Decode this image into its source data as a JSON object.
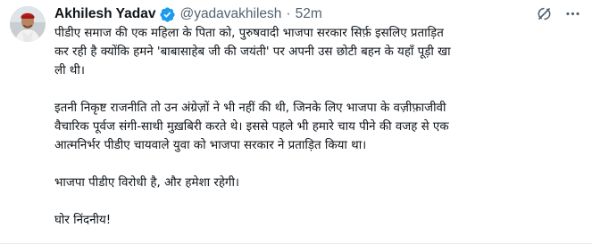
{
  "tweet": {
    "author": {
      "name": "Akhilesh Yadav",
      "handle": "@yadavakhilesh",
      "separator": "·",
      "time": "52m",
      "verified": true,
      "verified_color": "#1d9bf0",
      "avatar_icon": "profile-photo"
    },
    "actions": {
      "grok_icon": "grok-icon",
      "more_icon": "more-horizontal-icon"
    },
    "paragraphs": [
      {
        "lines": [
          "पीडीए समाज की एक महिला के पिता को, पुरुषवादी भाजपा सरकार सिर्फ़ इसलिए प्रताड़ित",
          "कर रही है क्योंकि हमने 'बाबासाहेब जी की जयंती' पर अपनी उस छोटी बहन के यहाँ पूड़ी खा",
          "ली थी।"
        ]
      },
      {
        "lines": [
          "इतनी निकृष्ट राजनीति तो उन अंग्रेज़ों ने भी नहीं की थी, जिनके लिए भाजपा के वज़ीफ़ाजीवी",
          "वैचारिक पूर्वज संगी-साथी मुख़बिरी करते थे। इससे पहले भी हमारे चाय पीने की वजह से एक",
          "आत्मनिर्भर पीडीए चायवाले युवा को भाजपा सरकार ने प्रताड़ित किया था।"
        ]
      },
      {
        "lines": [
          "भाजपा पीडीए विरोधी है, और हमेशा रहेगी।"
        ]
      },
      {
        "lines": [
          "घोर निंदनीय!"
        ]
      }
    ]
  }
}
